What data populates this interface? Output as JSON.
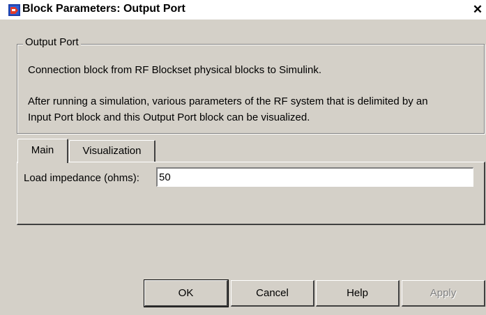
{
  "window": {
    "title": "Block Parameters: Output Port",
    "close_glyph": "✕",
    "app_icon": "simulink-block-icon"
  },
  "group": {
    "legend": "Output Port",
    "description_line1": "Connection block from RF Blockset physical blocks to Simulink.",
    "description_line2": "After running a simulation, various parameters of the RF system that is delimited by an",
    "description_line3": "Input Port block and this Output Port block can be visualized."
  },
  "tabs": [
    {
      "label": "Main",
      "selected": true
    },
    {
      "label": "Visualization",
      "selected": false
    }
  ],
  "main_tab": {
    "load_impedance_label": "Load impedance (ohms):",
    "load_impedance_value": "50"
  },
  "buttons": {
    "ok": "OK",
    "cancel": "Cancel",
    "help": "Help",
    "apply": "Apply"
  }
}
